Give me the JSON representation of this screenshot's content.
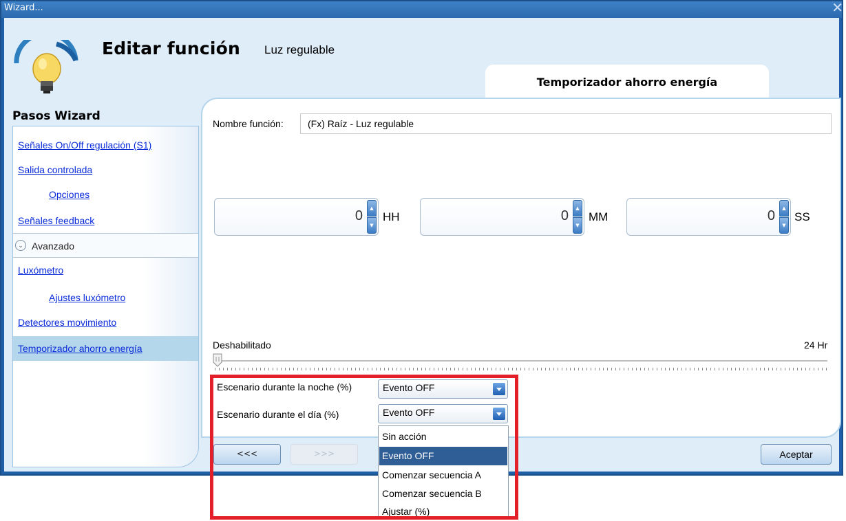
{
  "window": {
    "title": "Wizard..."
  },
  "header": {
    "title": "Editar función",
    "subtitle": "Luz regulable",
    "tab_label": "Temporizador ahorro energía"
  },
  "sidebar": {
    "heading": "Pasos Wizard",
    "items": [
      {
        "label": "Señales On/Off regulación (S1)"
      },
      {
        "label": "Salida controlada"
      },
      {
        "label": "Opciones"
      },
      {
        "label": "Señales feedback"
      },
      {
        "label": "Avanzado"
      },
      {
        "label": "Luxómetro"
      },
      {
        "label": "Ajustes luxómetro"
      },
      {
        "label": "Detectores movimiento"
      },
      {
        "label": "Temporizador ahorro energía"
      }
    ]
  },
  "form": {
    "name_label": "Nombre función:",
    "name_value": "(Fx) Raíz - Luz regulable",
    "time": [
      {
        "value": "0",
        "unit": "HH"
      },
      {
        "value": "0",
        "unit": "MM"
      },
      {
        "value": "0",
        "unit": "SS"
      }
    ],
    "slider": {
      "min_label": "Deshabilitado",
      "max_label": "24 Hr",
      "value_fraction": 0
    },
    "night_label": "Escenario durante la noche (%)",
    "night_value": "Evento OFF",
    "day_label": "Escenario durante el día (%)",
    "day_value": "Evento OFF",
    "dropdown_options": [
      "Sin acción",
      "Evento OFF",
      "Comenzar secuencia A",
      "Comenzar secuencia B",
      "Ajustar (%)"
    ],
    "dropdown_selected": "Evento OFF"
  },
  "buttons": {
    "back": "<<<",
    "next": ">>>",
    "accept": "Aceptar"
  },
  "colors": {
    "title_bar": "#2a69ad",
    "panel_bg": "#dfedf9",
    "selected_step": "#b4d7ec",
    "link": "#0a2bd8",
    "highlight": "#e3202a"
  }
}
